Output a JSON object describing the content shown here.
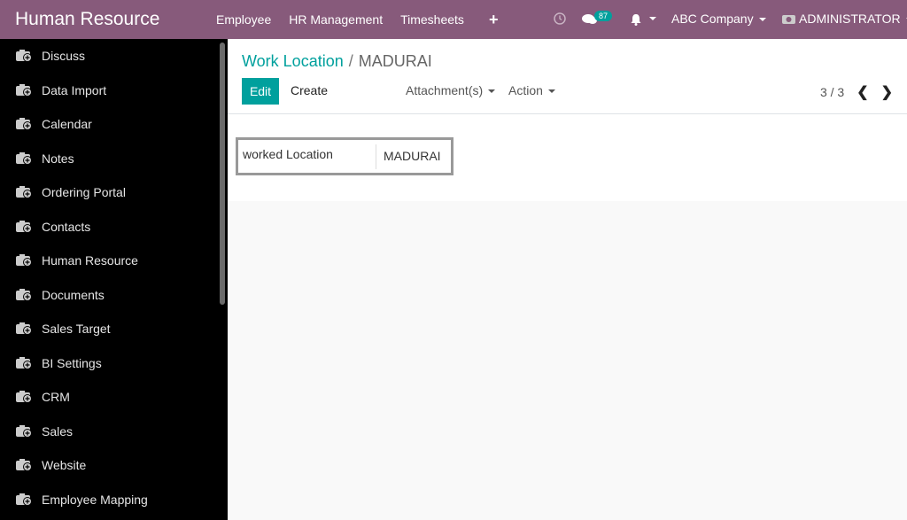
{
  "app": {
    "title": "Human Resource"
  },
  "topbar": {
    "menu": [
      "Employee",
      "HR Management",
      "Timesheets"
    ],
    "add_icon": "plus-icon",
    "chat_badge": "87",
    "company": "ABC Company",
    "user": "ADMINISTRATOR"
  },
  "sidebar": {
    "items": [
      {
        "label": "Discuss"
      },
      {
        "label": "Data Import"
      },
      {
        "label": "Calendar"
      },
      {
        "label": "Notes"
      },
      {
        "label": "Ordering Portal"
      },
      {
        "label": "Contacts"
      },
      {
        "label": "Human Resource"
      },
      {
        "label": "Documents"
      },
      {
        "label": "Sales Target"
      },
      {
        "label": "BI Settings"
      },
      {
        "label": "CRM"
      },
      {
        "label": "Sales"
      },
      {
        "label": "Website"
      },
      {
        "label": "Employee Mapping"
      }
    ]
  },
  "breadcrumb": {
    "parent": "Work Location",
    "separator": "/",
    "current": "MADURAI"
  },
  "toolbar": {
    "edit_label": "Edit",
    "create_label": "Create",
    "attachments_label": "Attachment(s)",
    "action_label": "Action"
  },
  "pager": {
    "value": "3 / 3"
  },
  "form": {
    "field_label": "worked Location",
    "field_value": "MADURAI"
  },
  "colors": {
    "brand": "#875a7b",
    "accent": "#00a09d"
  }
}
